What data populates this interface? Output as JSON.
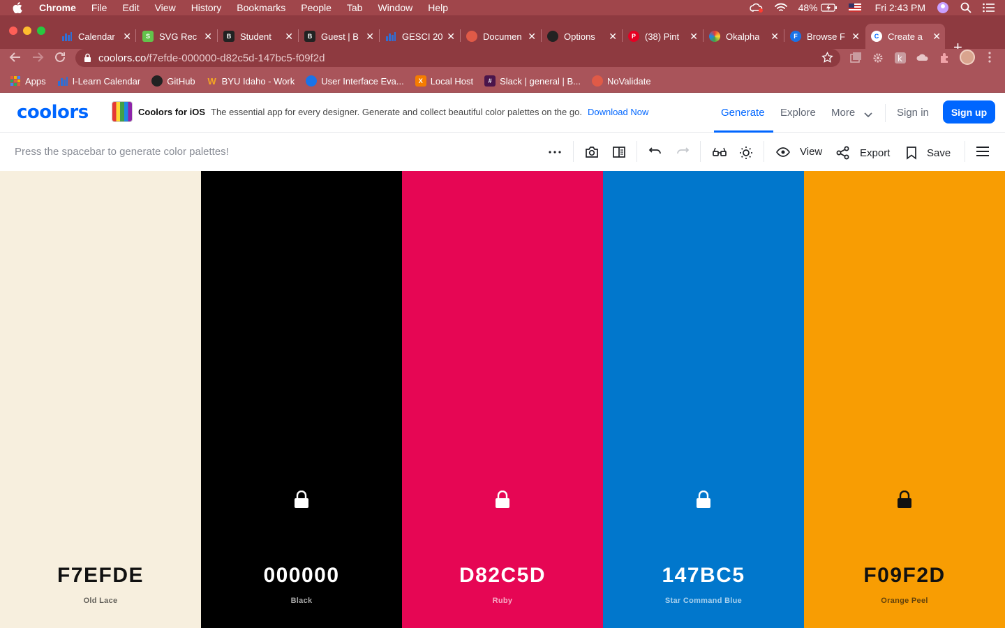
{
  "os_menu": {
    "app": "Chrome",
    "items": [
      "File",
      "Edit",
      "View",
      "History",
      "Bookmarks",
      "People",
      "Tab",
      "Window",
      "Help"
    ],
    "battery": "48%",
    "clock": "Fri 2:43 PM"
  },
  "tabs": [
    {
      "title": "Calendar",
      "icon": "bar-chart-icon",
      "color": "#2f6fd6"
    },
    {
      "title": "SVG Rec",
      "icon": "svg-icon",
      "color": "#63c34b"
    },
    {
      "title": "Student",
      "icon": "byu-icon",
      "color": "#222222"
    },
    {
      "title": "Guest | B",
      "icon": "byu-icon",
      "color": "#222222"
    },
    {
      "title": "GESCI 20",
      "icon": "bar-chart-icon",
      "color": "#2f6fd6"
    },
    {
      "title": "Documen",
      "icon": "doc-icon",
      "color": "#e05a47"
    },
    {
      "title": "Options",
      "icon": "github-icon",
      "color": "#222222"
    },
    {
      "title": "(38) Pint",
      "icon": "pinterest-icon",
      "color": "#e60023"
    },
    {
      "title": "Okalpha",
      "icon": "okalpha-icon",
      "color": "#222222"
    },
    {
      "title": "Browse F",
      "icon": "f-icon",
      "color": "#1a73e8"
    },
    {
      "title": "Create a",
      "icon": "coolors-icon",
      "color": "#0066ff"
    }
  ],
  "address": {
    "host": "coolors.co",
    "path": "/f7efde-000000-d82c5d-147bc5-f09f2d"
  },
  "bookmarks": [
    {
      "label": "Apps",
      "icon": "apps-grid-icon",
      "color": "#e35d3b"
    },
    {
      "label": "I-Learn Calendar",
      "icon": "bar-chart-icon",
      "color": "#2f6fd6"
    },
    {
      "label": "GitHub",
      "icon": "github-icon",
      "color": "#222222"
    },
    {
      "label": "BYU Idaho - Work",
      "icon": "workday-icon",
      "color": "#f5a623"
    },
    {
      "label": "User Interface Eva...",
      "icon": "globe-icon",
      "color": "#1a73e8"
    },
    {
      "label": "Local Host",
      "icon": "xampp-icon",
      "color": "#f57c00"
    },
    {
      "label": "Slack | general | B...",
      "icon": "slack-icon",
      "color": "#4a154b"
    },
    {
      "label": "NoValidate",
      "icon": "doc-icon",
      "color": "#e05a47"
    }
  ],
  "site": {
    "logo": "coolors",
    "promo_title": "Coolors for iOS",
    "promo_text": "The essential app for every designer. Generate and collect beautiful color palettes on the go.",
    "promo_link": "Download Now",
    "nav": {
      "generate": "Generate",
      "explore": "Explore",
      "more": "More",
      "signin": "Sign in",
      "signup": "Sign up"
    }
  },
  "toolbar": {
    "hint": "Press the spacebar to generate color palettes!",
    "view": "View",
    "export": "Export",
    "save": "Save"
  },
  "palette": [
    {
      "hex": "F7EFDE",
      "name": "Old Lace",
      "bg": "#f7efde",
      "fg": "#111111",
      "locked": false
    },
    {
      "hex": "000000",
      "name": "Black",
      "bg": "#000000",
      "fg": "#ffffff",
      "locked": true
    },
    {
      "hex": "D82C5D",
      "name": "Ruby",
      "bg": "#e60654",
      "fg": "#ffffff",
      "locked": true
    },
    {
      "hex": "147BC5",
      "name": "Star Command Blue",
      "bg": "#0177cc",
      "fg": "#ffffff",
      "locked": true
    },
    {
      "hex": "F09F2D",
      "name": "Orange Peel",
      "bg": "#f89d03",
      "fg": "#111111",
      "locked": true
    }
  ],
  "colors": {
    "accent": "#0066ff",
    "chrome_frame": "#8e3a40",
    "chrome_toolbar": "#a9545a"
  }
}
